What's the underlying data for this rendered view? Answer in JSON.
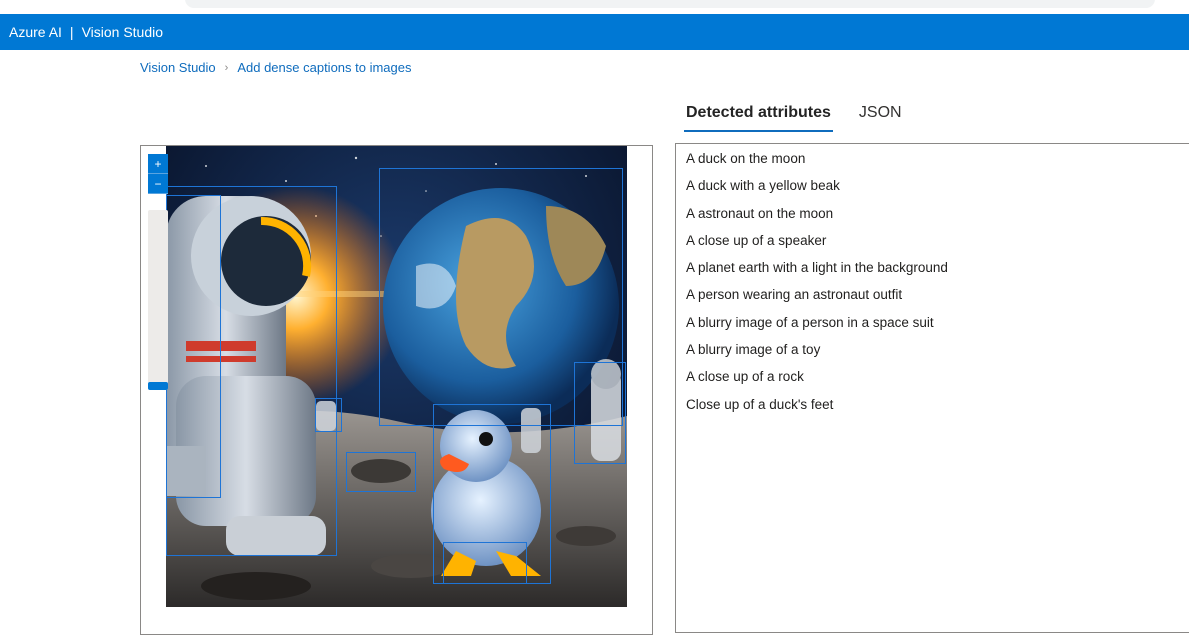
{
  "header": {
    "brand": "Azure AI",
    "separator": "|",
    "product": "Vision Studio"
  },
  "breadcrumb": {
    "root": "Vision Studio",
    "current": "Add dense captions to images"
  },
  "viewer": {
    "zoom_in_icon": "plus-icon",
    "zoom_out_icon": "minus-icon",
    "image_description": "",
    "zoom_level": 1
  },
  "tabs": [
    {
      "label": "Detected attributes",
      "active": true
    },
    {
      "label": "JSON",
      "active": false
    }
  ],
  "captions": [
    "A duck on the moon",
    "A duck with a yellow beak",
    "A astronaut on the moon",
    "A close up of a speaker",
    "A planet earth with a light in the background",
    "A person wearing an astronaut outfit",
    "A blurry image of a person in a space suit",
    "A blurry image of a toy",
    "A close up of a rock",
    "Close up of a duck's feet"
  ],
  "colors": {
    "accent": "#0078d4",
    "link": "#0f6cbd",
    "bbox": "#1e74d6"
  }
}
